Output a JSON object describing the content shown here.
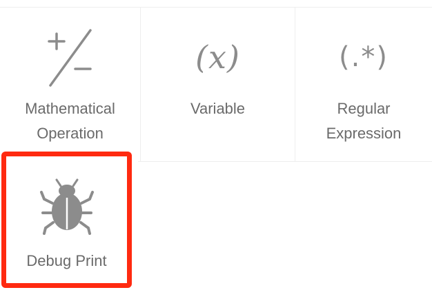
{
  "tiles": [
    {
      "id": "math",
      "label": "Mathematical\nOperation",
      "icon": "plus-minus-icon"
    },
    {
      "id": "variable",
      "label": "Variable",
      "icon": "variable-x-icon",
      "glyph": "(x)"
    },
    {
      "id": "regex",
      "label": "Regular\nExpression",
      "icon": "regex-icon",
      "glyph": "(.*)"
    },
    {
      "id": "debug",
      "label": "Debug Print",
      "icon": "bug-icon"
    }
  ],
  "highlight": {
    "target": "debug",
    "color": "#ff2a10"
  },
  "colors": {
    "icon": "#8c8c8c",
    "label": "#6a6a6a",
    "divider": "#eeeeee"
  }
}
